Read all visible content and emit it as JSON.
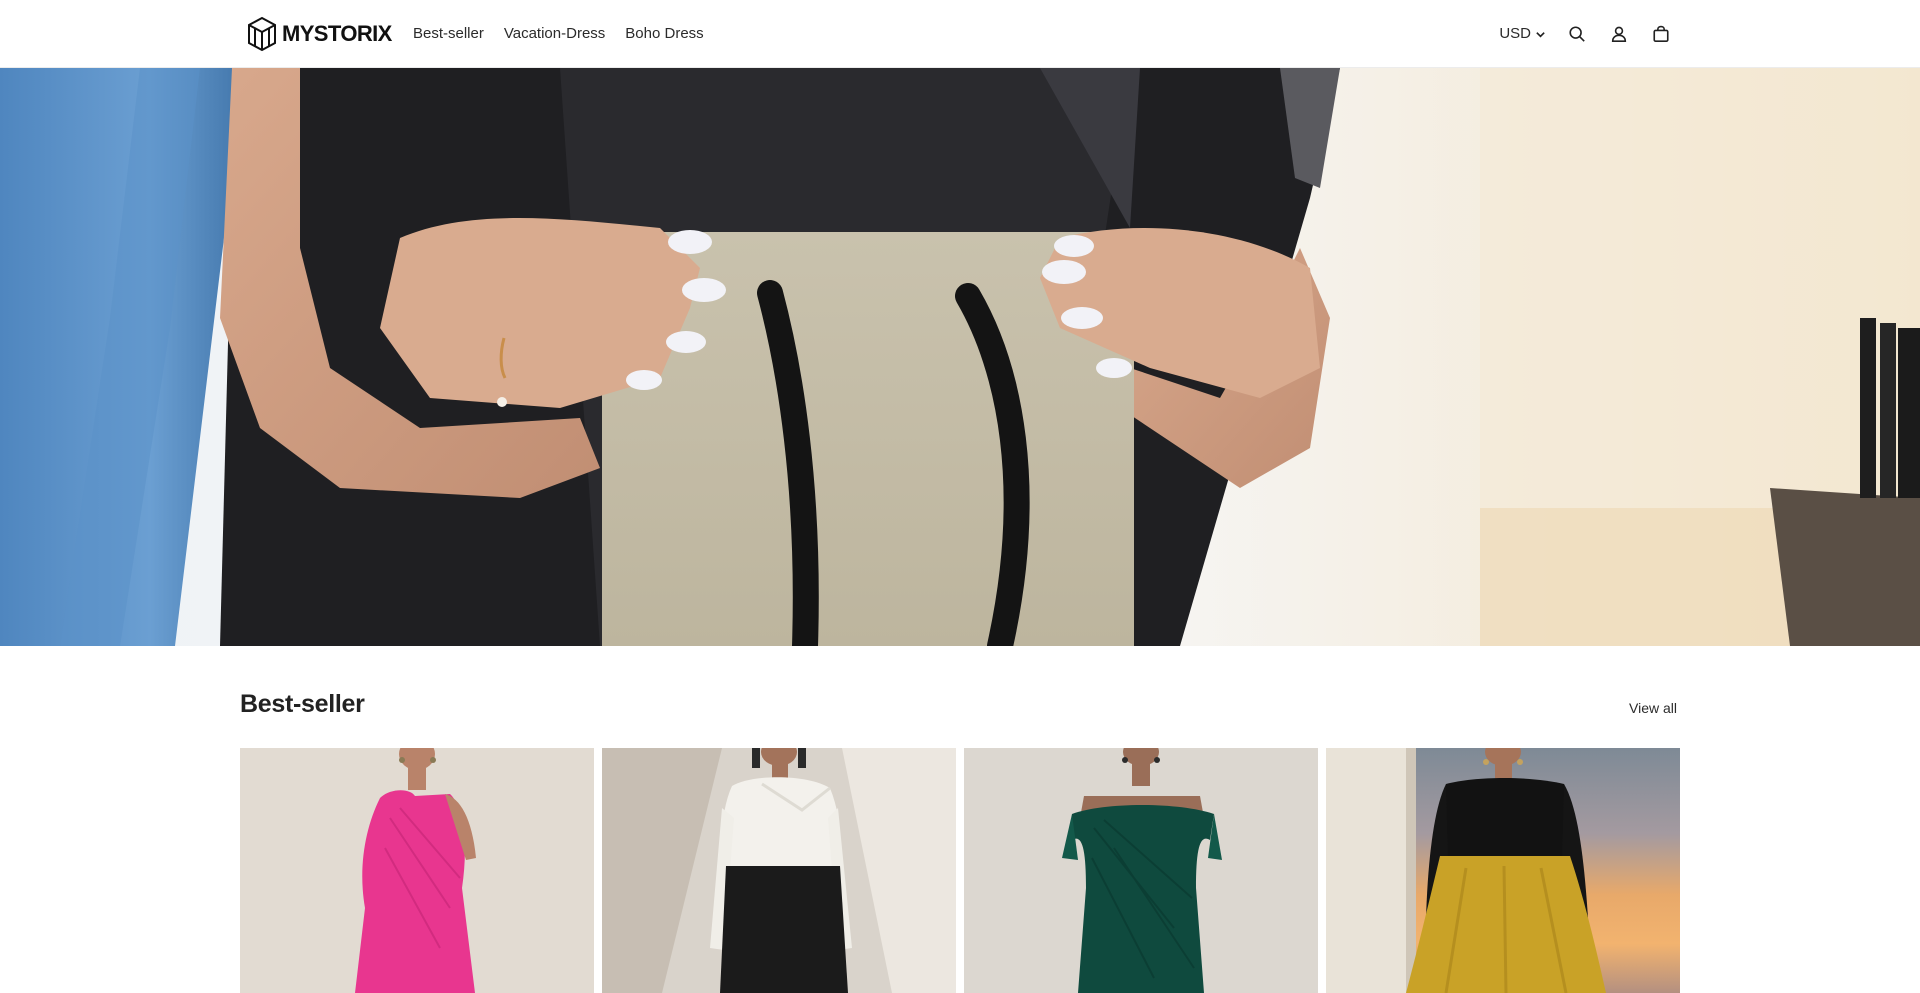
{
  "header": {
    "logo_text": "MYSTORIX",
    "nav": [
      {
        "label": "Best-seller"
      },
      {
        "label": "Vacation-Dress"
      },
      {
        "label": "Boho Dress"
      }
    ],
    "currency": "USD",
    "icons": [
      "search-icon",
      "account-icon",
      "cart-icon"
    ]
  },
  "hero": {
    "image": "hands-holding-kraft-shopping-bag"
  },
  "best_seller": {
    "title": "Best-seller",
    "view_all": "View all",
    "products": [
      {
        "image": "pink-one-shoulder-pleated-dress",
        "color": "#e8368f"
      },
      {
        "image": "white-black-long-sleeve-dress",
        "color": "#f2f0ea"
      },
      {
        "image": "emerald-off-shoulder-dress",
        "color": "#0f4a3e"
      },
      {
        "image": "black-top-gold-satin-skirt",
        "color": "#c9a227"
      }
    ]
  }
}
